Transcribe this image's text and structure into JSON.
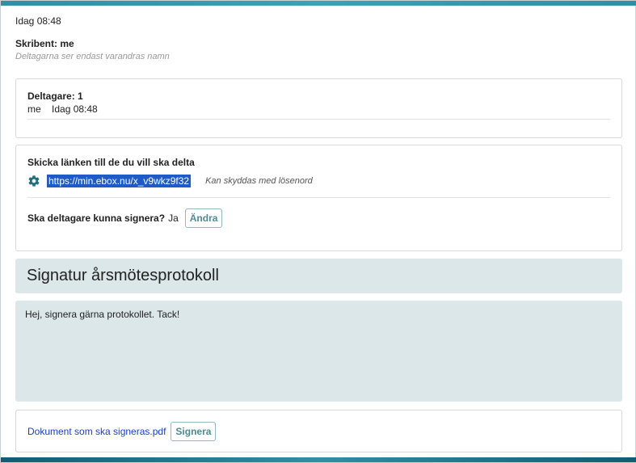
{
  "header": {
    "time": "Idag 08:48",
    "writer_label": "Skribent: me",
    "writer_hint": "Deltagarna ser endast varandras namn"
  },
  "participants": {
    "label": "Deltagare: 1",
    "rows": [
      {
        "name": "me",
        "time": "Idag 08:48"
      }
    ]
  },
  "share": {
    "label": "Skicka länken till de du vill ska delta",
    "url": "https://min.ebox.nu/x_v9wkz9f32",
    "hint": "Kan skyddas med lösenord",
    "icon": "gear-icon",
    "sign_question": "Ska deltagare kunna signera?",
    "sign_answer": "Ja",
    "change_label": "Ändra"
  },
  "title": "Signatur årsmötesprotokoll",
  "message": "Hej, signera gärna protokollet. Tack!",
  "document": {
    "file_name": "Dokument som ska signeras.pdf",
    "sign_label": "Signera"
  },
  "colors": {
    "accent": "#2f8fa5",
    "panel": "#dce7ea",
    "link": "#1a3fc7",
    "button_text": "#4e8a92"
  }
}
